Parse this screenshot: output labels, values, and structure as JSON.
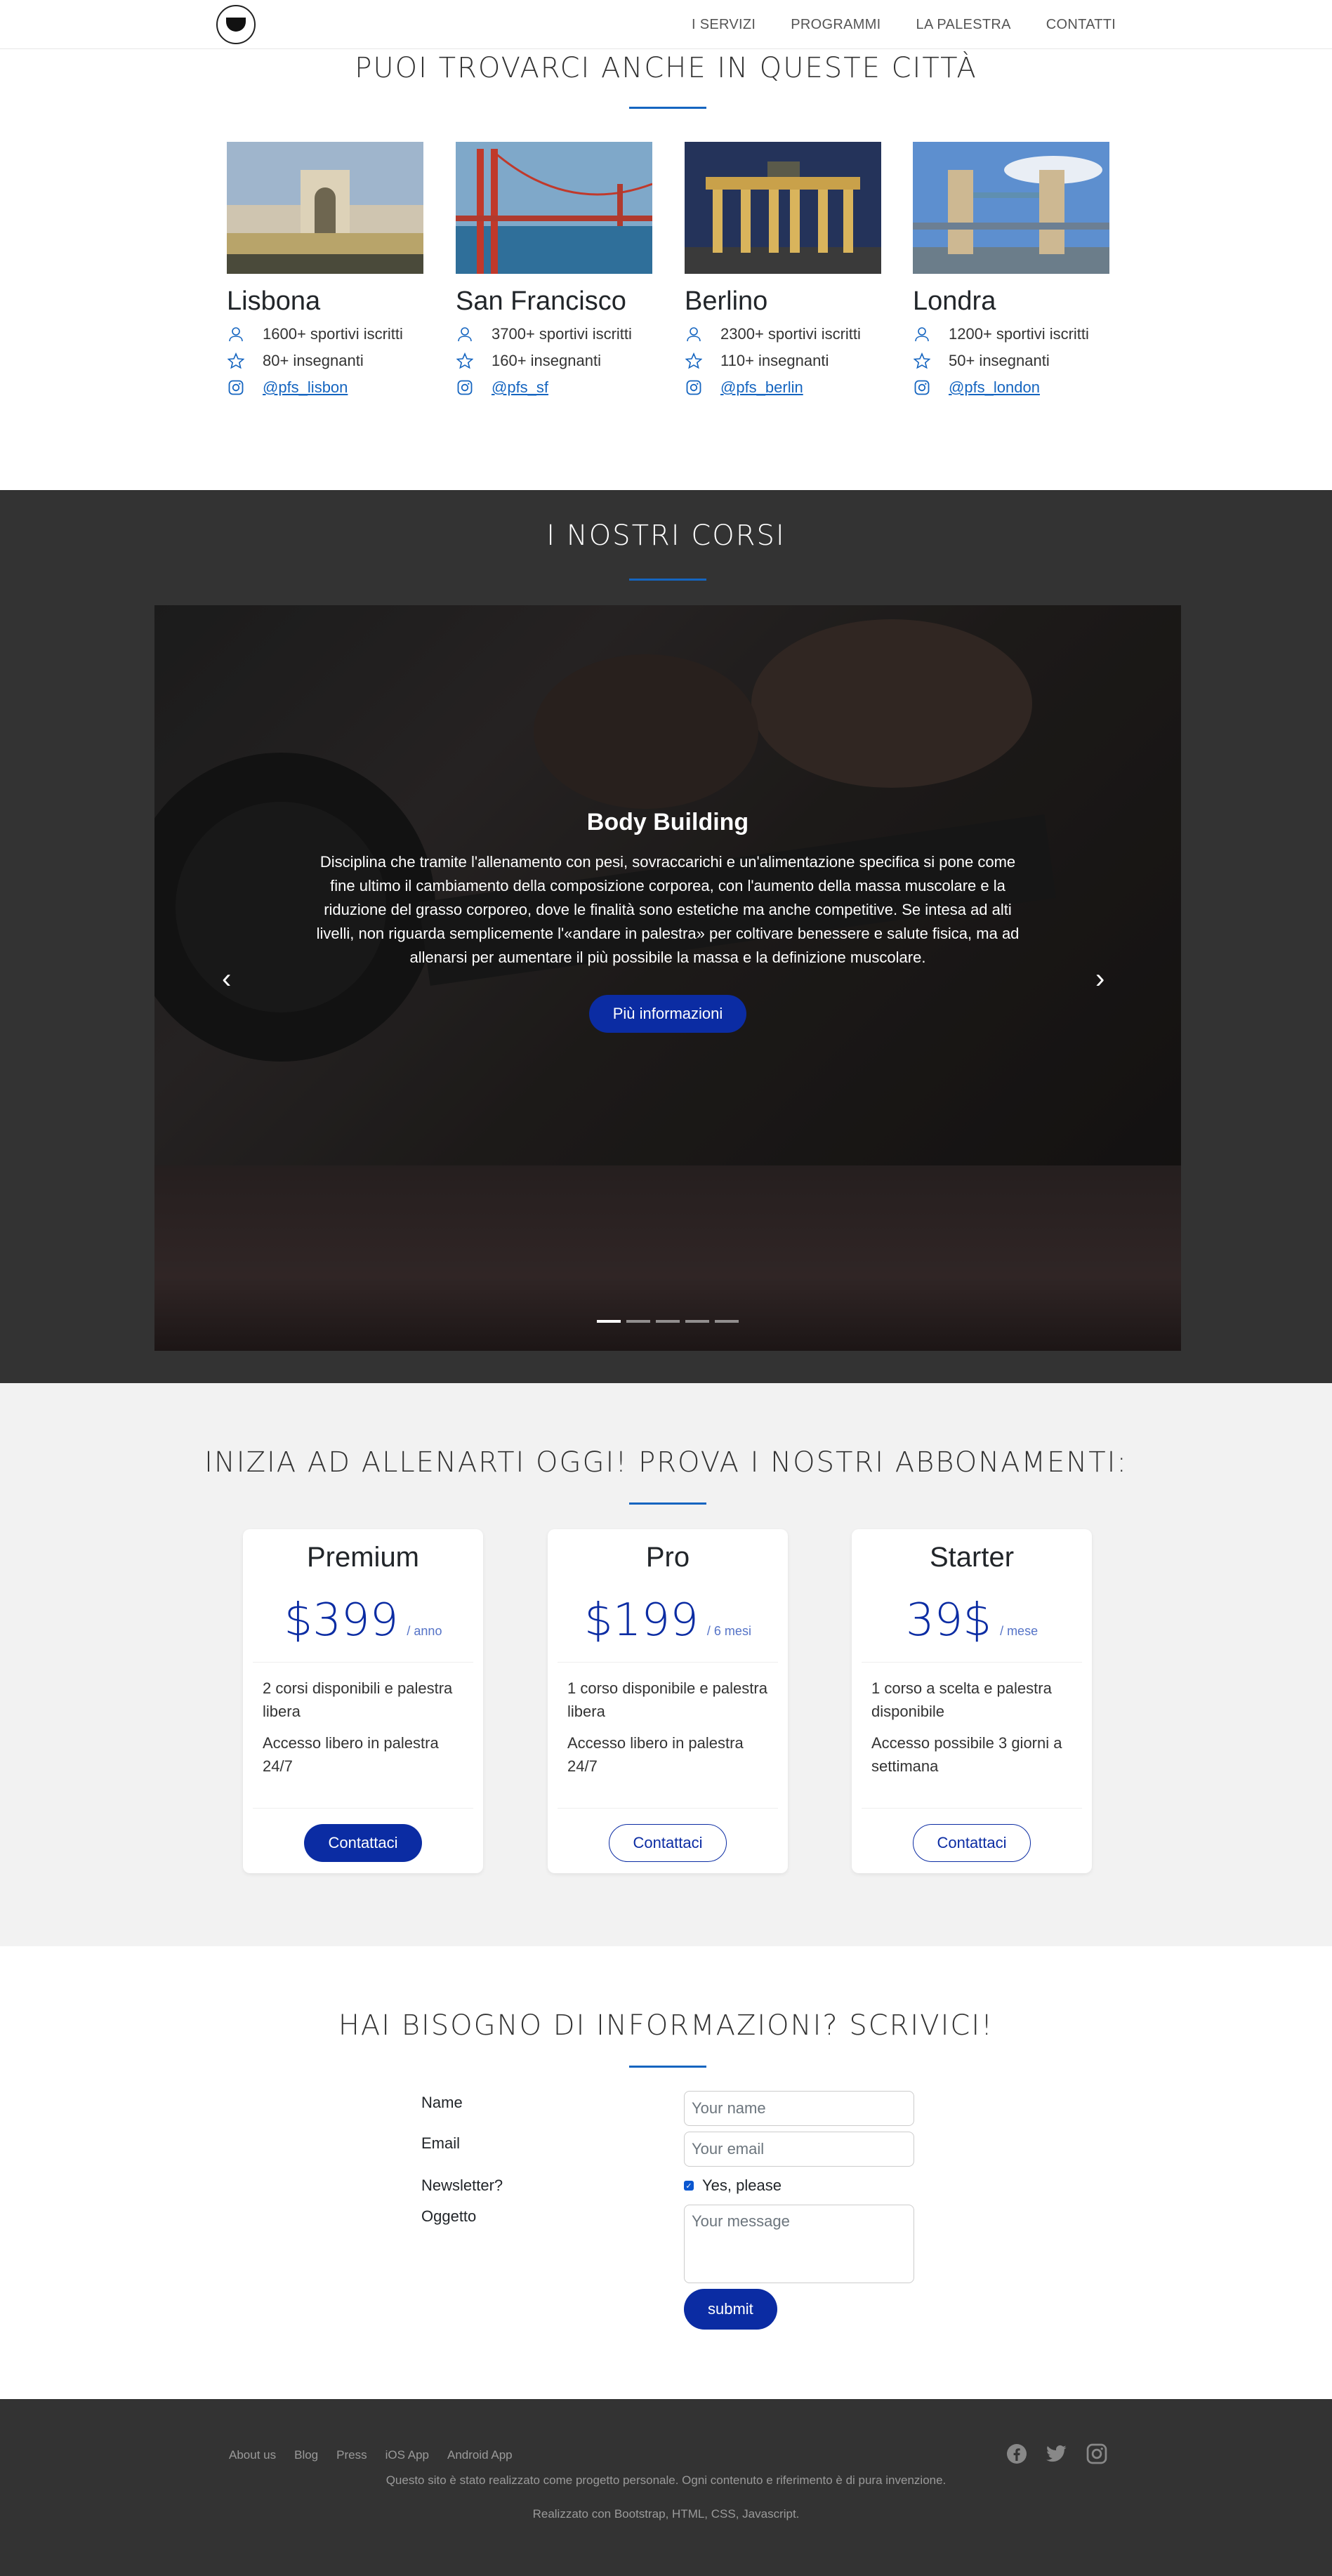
{
  "nav": {
    "items": [
      "I SERVIZI",
      "PROGRAMMI",
      "LA PALESTRA",
      "CONTATTI"
    ]
  },
  "cities_section": {
    "title": "PUOI TROVARCI ANCHE IN QUESTE CITTÀ",
    "cities": [
      {
        "name": "Lisbona",
        "members": "1600+ sportivi iscritti",
        "teachers": "80+ insegnanti",
        "instagram": "@pfs_lisbon"
      },
      {
        "name": "San Francisco",
        "members": "3700+ sportivi iscritti",
        "teachers": "160+ insegnanti",
        "instagram": "@pfs_sf"
      },
      {
        "name": "Berlino",
        "members": "2300+ sportivi iscritti",
        "teachers": "110+ insegnanti",
        "instagram": "@pfs_berlin"
      },
      {
        "name": "Londra",
        "members": "1200+ sportivi iscritti",
        "teachers": "50+ insegnanti",
        "instagram": "@pfs_london"
      }
    ]
  },
  "courses_section": {
    "title": "I NOSTRI CORSI",
    "slide_title": "Body Building",
    "slide_text": "Disciplina che tramite l'allenamento con pesi, sovraccarichi e un'alimentazione specifica si pone come fine ultimo il cambiamento della composizione corporea, con l'aumento della massa muscolare e la riduzione del grasso corporeo, dove le finalità sono estetiche ma anche competitive. Se intesa ad alti livelli, non riguarda semplicemente l'«andare in palestra» per coltivare benessere e salute fisica, ma ad allenarsi per aumentare il più possibile la massa e la definizione muscolare.",
    "button": "Più informazioni",
    "prev_arrow": "‹",
    "next_arrow": "›"
  },
  "pricing_section": {
    "title": "INIZIA AD ALLENARTI OGGI! PROVA I NOSTRI ABBONAMENTI:",
    "plans": [
      {
        "name": "Premium",
        "price": "$399",
        "period": "/ anno",
        "features": [
          "2 corsi disponibili e palestra libera",
          "Accesso libero in palestra 24/7"
        ],
        "button": "Contattaci"
      },
      {
        "name": "Pro",
        "price": "$199",
        "period": "/ 6 mesi",
        "features": [
          "1 corso disponibile e palestra libera",
          "Accesso libero in palestra 24/7"
        ],
        "button": "Contattaci"
      },
      {
        "name": "Starter",
        "price": "39$",
        "period": "/ mese",
        "features": [
          "1 corso a scelta e palestra disponibile",
          "Accesso possibile 3 giorni a settimana"
        ],
        "button": "Contattaci"
      }
    ]
  },
  "contact_section": {
    "title": "HAI BISOGNO DI INFORMAZIONI? SCRIVICI!",
    "name_label": "Name",
    "name_placeholder": "Your name",
    "email_label": "Email",
    "email_placeholder": "Your email",
    "newsletter_label": "Newsletter?",
    "newsletter_option": "Yes, please",
    "subject_label": "Oggetto",
    "message_placeholder": "Your message",
    "submit": "submit"
  },
  "footer": {
    "links": [
      "About us",
      "Blog",
      "Press",
      "iOS App",
      "Android App"
    ],
    "line1": "Questo sito è stato realizzato come progetto personale. Ogni contenuto e riferimento è di pura invenzione.",
    "line2": "Realizzato con Bootstrap, HTML, CSS, Javascript."
  },
  "colors": {
    "accent": "#0b2ca3",
    "rule": "#1565c0",
    "dark": "#333333"
  }
}
